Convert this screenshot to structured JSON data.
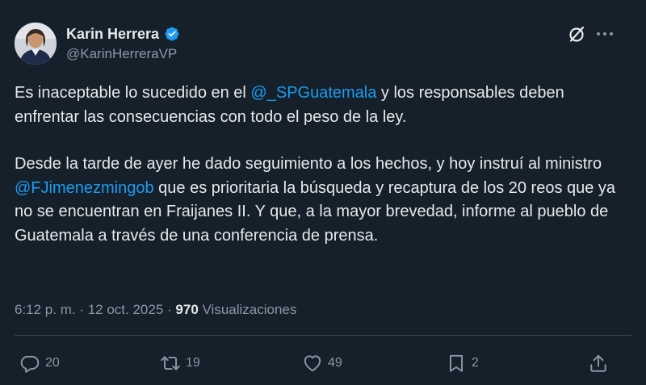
{
  "author": {
    "display_name": "Karin Herrera",
    "handle": "@KarinHerreraVP",
    "verified": true,
    "avatar_icon": "profile-photo",
    "verified_color": "#1d9bf0"
  },
  "header_icons": {
    "grok": "grok-icon",
    "more": "more-icon"
  },
  "tweet": {
    "p1_text_a": "Es inaceptable lo sucedido en el ",
    "p1_mention": "@_SPGuatemala",
    "p1_text_b": " y los responsables deben enfrentar las consecuencias con todo el peso de la ley.",
    "p2_text_a": "Desde la tarde de ayer he dado seguimiento a los hechos, y hoy instruí al ministro ",
    "p2_mention": "@FJimenezmingob",
    "p2_text_b": " que es prioritaria la búsqueda y recaptura de los 20 reos que ya no se encuentran en Fraijanes II. Y que, a la mayor brevedad, informe al pueblo de Guatemala a través de una conferencia de prensa."
  },
  "meta": {
    "time": "6:12 p. m.",
    "sep1": " · ",
    "date": "12 oct. 2025",
    "sep2": " · ",
    "views_count": "970",
    "views_label": " Visualizaciones"
  },
  "actions": {
    "reply_count": "20",
    "retweet_count": "19",
    "like_count": "49",
    "bookmark_count": "2"
  },
  "colors": {
    "background": "#15202b",
    "text": "#e7e9ea",
    "secondary": "#8b98a5",
    "accent": "#1d9bf0",
    "divider": "#38444d"
  }
}
